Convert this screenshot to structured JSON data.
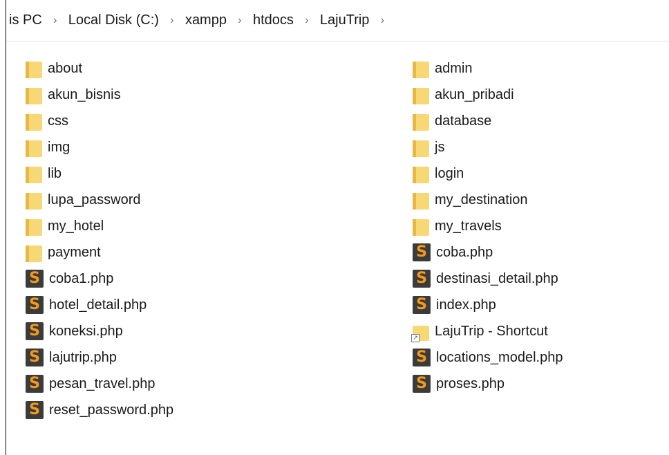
{
  "breadcrumb": {
    "items": [
      "is PC",
      "Local Disk (C:)",
      "xampp",
      "htdocs",
      "LajuTrip"
    ],
    "separator": "›"
  },
  "files": {
    "left": [
      {
        "name": "about",
        "type": "folder"
      },
      {
        "name": "akun_bisnis",
        "type": "folder"
      },
      {
        "name": "css",
        "type": "folder"
      },
      {
        "name": "img",
        "type": "folder"
      },
      {
        "name": "lib",
        "type": "folder"
      },
      {
        "name": "lupa_password",
        "type": "folder"
      },
      {
        "name": "my_hotel",
        "type": "folder"
      },
      {
        "name": "payment",
        "type": "folder"
      },
      {
        "name": "coba1.php",
        "type": "php"
      },
      {
        "name": "hotel_detail.php",
        "type": "php"
      },
      {
        "name": "koneksi.php",
        "type": "php"
      },
      {
        "name": "lajutrip.php",
        "type": "php"
      },
      {
        "name": "pesan_travel.php",
        "type": "php"
      },
      {
        "name": "reset_password.php",
        "type": "php"
      }
    ],
    "right": [
      {
        "name": "admin",
        "type": "folder"
      },
      {
        "name": "akun_pribadi",
        "type": "folder"
      },
      {
        "name": "database",
        "type": "folder"
      },
      {
        "name": "js",
        "type": "folder"
      },
      {
        "name": "login",
        "type": "folder"
      },
      {
        "name": "my_destination",
        "type": "folder"
      },
      {
        "name": "my_travels",
        "type": "folder"
      },
      {
        "name": "coba.php",
        "type": "php"
      },
      {
        "name": "destinasi_detail.php",
        "type": "php"
      },
      {
        "name": "index.php",
        "type": "php"
      },
      {
        "name": "LajuTrip - Shortcut",
        "type": "shortcut"
      },
      {
        "name": "locations_model.php",
        "type": "php"
      },
      {
        "name": "proses.php",
        "type": "php"
      }
    ]
  },
  "colors": {
    "folder": "#f8d775",
    "php_bg": "#3b3b3b",
    "php_fg": "#f49a1a"
  }
}
